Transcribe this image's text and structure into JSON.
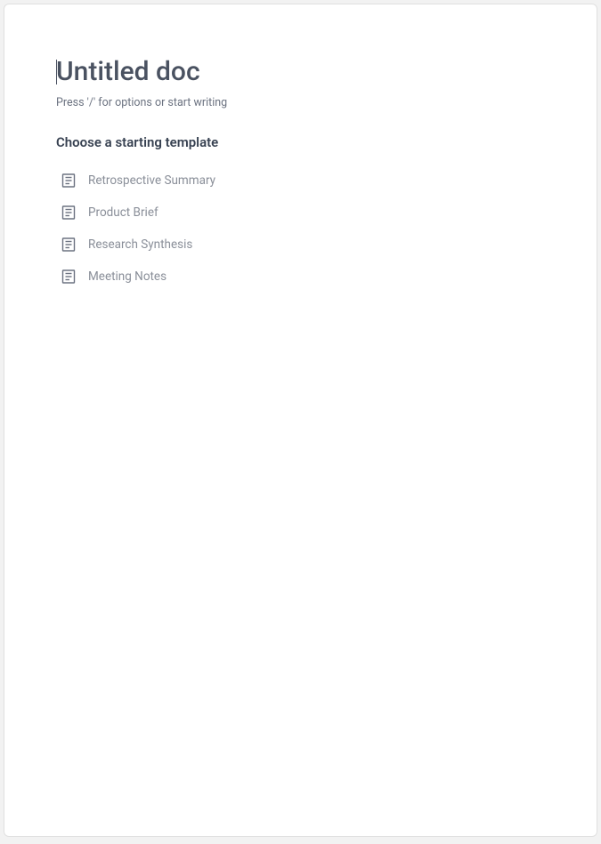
{
  "document": {
    "title": "Untitled doc",
    "hint": "Press '/' for options or start writing"
  },
  "templates": {
    "heading": "Choose a starting template",
    "items": [
      {
        "label": "Retrospective Summary"
      },
      {
        "label": "Product Brief"
      },
      {
        "label": "Research Synthesis"
      },
      {
        "label": "Meeting Notes"
      }
    ]
  }
}
